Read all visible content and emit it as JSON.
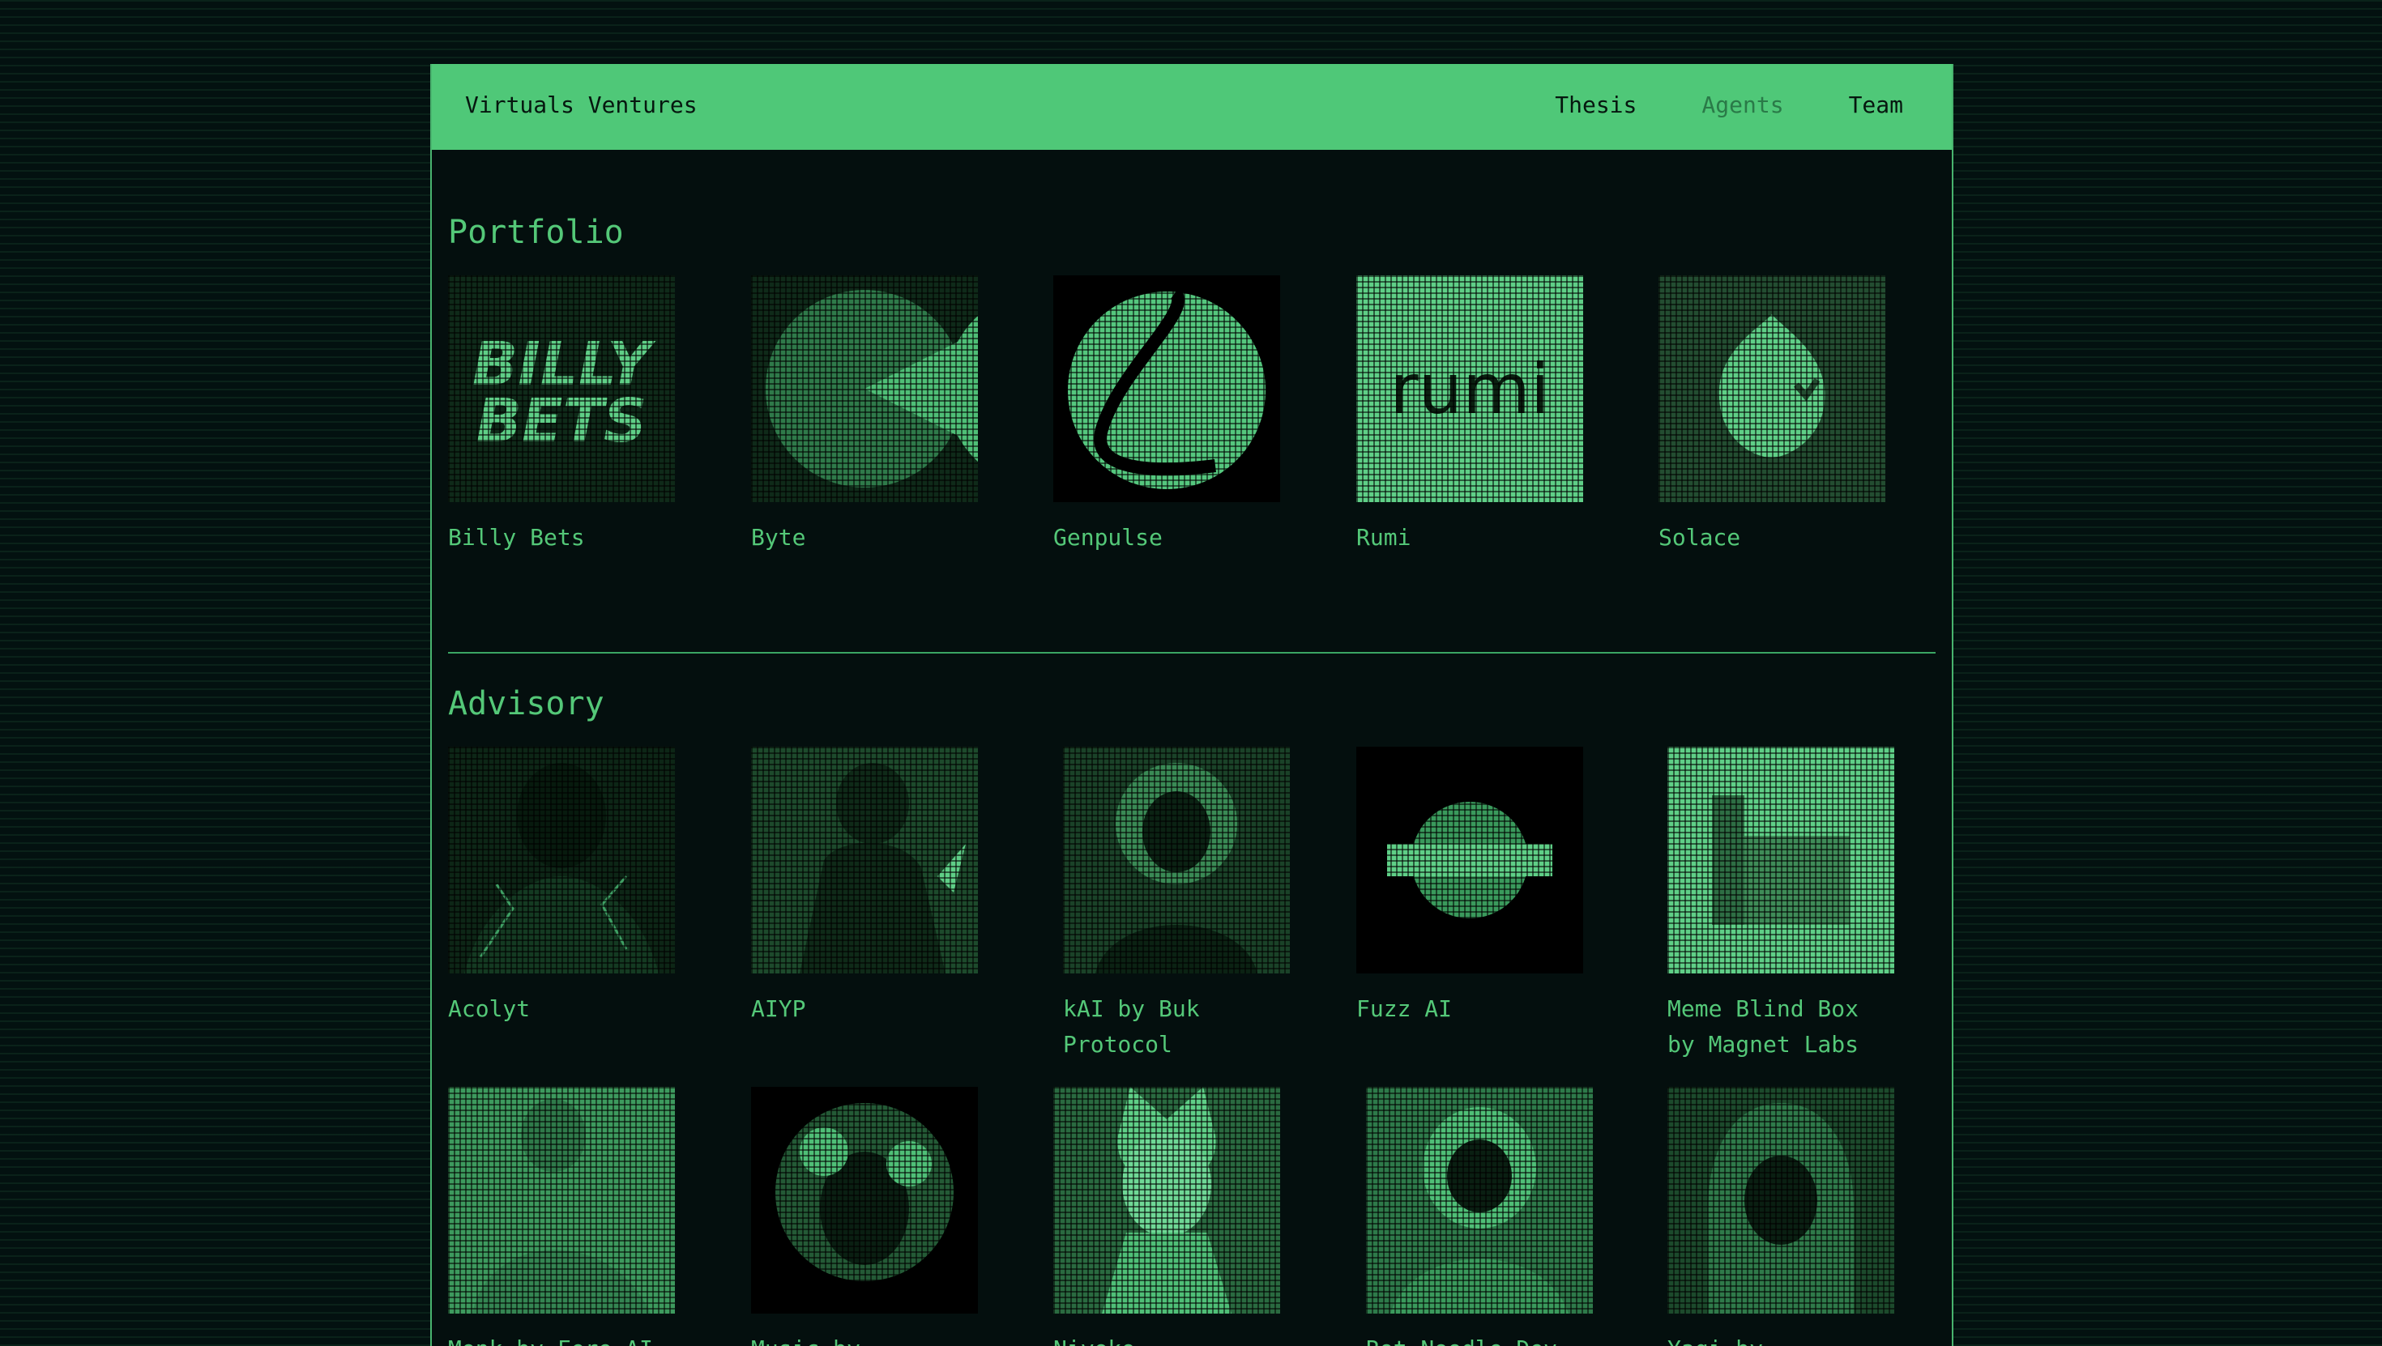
{
  "header": {
    "brand": "Virtuals Ventures",
    "nav": [
      "Thesis",
      "Agents",
      "Team"
    ]
  },
  "portfolio": {
    "title": "Portfolio",
    "items": [
      {
        "name": "Billy Bets",
        "icon": "billy-bets-logo-icon"
      },
      {
        "name": "Byte",
        "icon": "byte-logo-icon"
      },
      {
        "name": "Genpulse",
        "icon": "genpulse-logo-icon"
      },
      {
        "name": "Rumi",
        "icon": "rumi-logo-icon"
      },
      {
        "name": "Solace",
        "icon": "solace-logo-icon"
      }
    ]
  },
  "advisory": {
    "title": "Advisory",
    "items": [
      {
        "name": "Acolyt"
      },
      {
        "name": "AIYP"
      },
      {
        "name": "kAI by Buk Protocol"
      },
      {
        "name": "Fuzz AI"
      },
      {
        "name": "Meme Blind Box by Magnet Labs"
      },
      {
        "name": "Monk by Fere AI"
      },
      {
        "name": "Music by Virtuals"
      },
      {
        "name": "Niyoko"
      },
      {
        "name": "Rot Noodle Dev by"
      },
      {
        "name": "Yaqi by Ringfence"
      }
    ]
  },
  "colors": {
    "accent": "#4fc878",
    "background": "#031110"
  }
}
